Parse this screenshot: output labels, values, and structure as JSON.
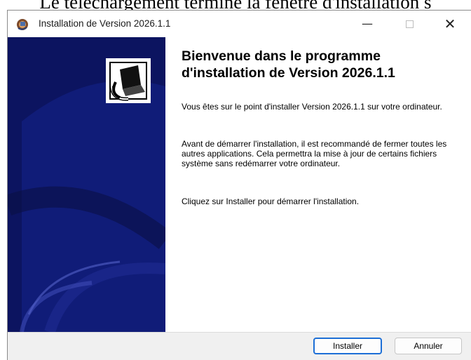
{
  "overlay_text": "Le téléchargement terminé la fenêtre d'installation s",
  "window": {
    "title": "Installation de Version 2026.1.1",
    "controls": {
      "minimize": "—",
      "close": "✕"
    }
  },
  "content": {
    "heading": "Bienvenue dans le programme d'installation de Version 2026.1.1",
    "paragraphs": [
      "Vous êtes sur le point d'installer Version 2026.1.1 sur votre ordinateur.",
      "Avant de démarrer l'installation, il est recommandé de fermer toutes les autres applications. Cela permettra la mise à jour de certains fichiers système sans redémarrer votre ordinateur.",
      "Cliquez sur Installer pour démarrer l'installation."
    ]
  },
  "buttons": {
    "install": "Installer",
    "cancel": "Annuler"
  },
  "colors": {
    "banner": "#0c1460",
    "accent": "#1d6fd6"
  },
  "icons": {
    "app": "installer-app-icon",
    "banner": "installer-computer-icon"
  }
}
